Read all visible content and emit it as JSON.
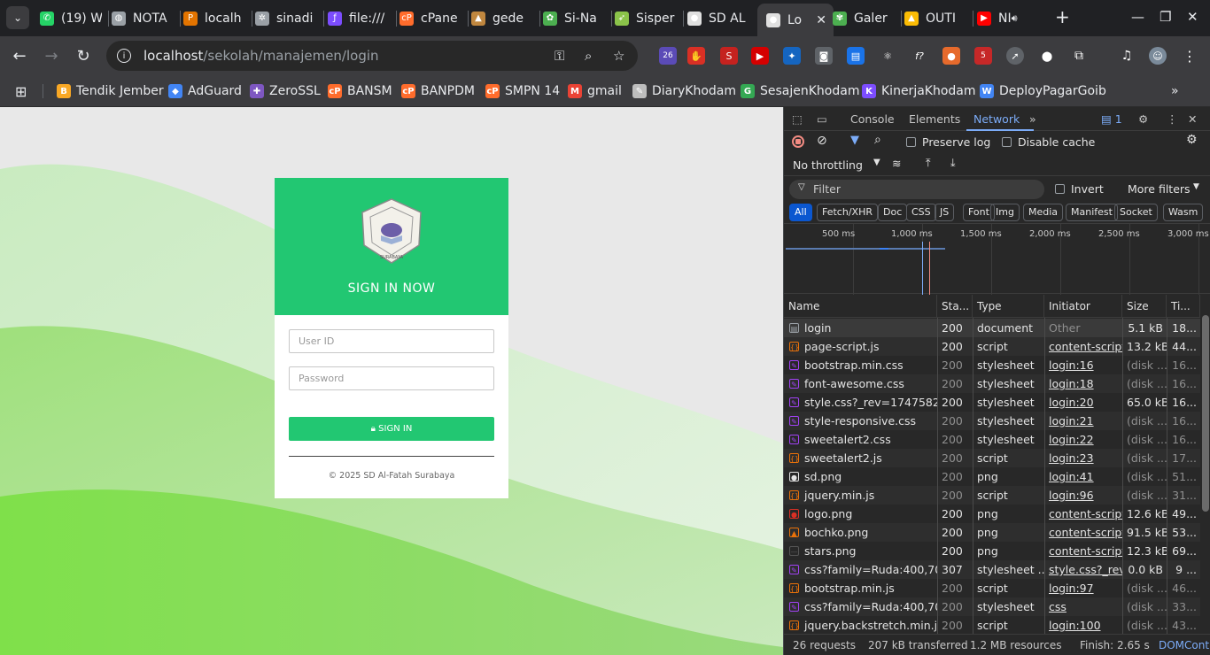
{
  "tabs": [
    {
      "label": "(19) W",
      "color": "#25d366",
      "glyph": "✆"
    },
    {
      "label": "NOTA",
      "color": "#9aa0a6",
      "glyph": "◍"
    },
    {
      "label": "localh",
      "color": "#e37400",
      "glyph": "P"
    },
    {
      "label": "sinadi",
      "color": "#9aa0a6",
      "glyph": "✲"
    },
    {
      "label": "file:///",
      "color": "#7c4dff",
      "glyph": "ƒ"
    },
    {
      "label": "cPane",
      "color": "#ff6c2c",
      "glyph": "cP"
    },
    {
      "label": "gede",
      "color": "#c0873f",
      "glyph": "▲"
    },
    {
      "label": "Si-Na",
      "color": "#4caf50",
      "glyph": "✿"
    },
    {
      "label": "Sisper",
      "color": "#8bc34a",
      "glyph": "➶"
    },
    {
      "label": "SD AL",
      "color": "#e0e0e0",
      "glyph": "●"
    },
    {
      "label": "Lo",
      "color": "#e0e0e0",
      "glyph": "●"
    },
    {
      "label": "Galer",
      "color": "#4caf50",
      "glyph": "✾"
    },
    {
      "label": "OUTI",
      "color": "#fbbc04",
      "glyph": "▲"
    },
    {
      "label": "NI",
      "color": "#ff0000",
      "glyph": "▶"
    }
  ],
  "address": {
    "host": "localhost",
    "path": "/sekolah/manajemen/login"
  },
  "extensions": {
    "badge1": "26",
    "badge2": "5"
  },
  "bookmarks": [
    {
      "label": "Tendik Jember",
      "color": "#f9a825",
      "glyph": "B"
    },
    {
      "label": "AdGuard",
      "color": "#4285f4",
      "glyph": "◆"
    },
    {
      "label": "ZeroSSL",
      "color": "#7e57c2",
      "glyph": "✚"
    },
    {
      "label": "BANSM",
      "color": "#ff6c2c",
      "glyph": "cP"
    },
    {
      "label": "BANPDM",
      "color": "#ff6c2c",
      "glyph": "cP"
    },
    {
      "label": "SMPN 14",
      "color": "#ff6c2c",
      "glyph": "cP"
    },
    {
      "label": "gmail",
      "color": "#ea4335",
      "glyph": "M"
    },
    {
      "label": "DiaryKhodam",
      "color": "#bdbdbd",
      "glyph": "✎"
    },
    {
      "label": "SesajenKhodam",
      "color": "#34a853",
      "glyph": "G"
    },
    {
      "label": "KinerjaKhodam",
      "color": "#7c4dff",
      "glyph": "K"
    },
    {
      "label": "DeployPagarGoib",
      "color": "#4285f4",
      "glyph": "W"
    }
  ],
  "login": {
    "logo_text_top": "SEKOLAH DASAR AL-FATAH",
    "logo_text_bottom": "SURABAYA",
    "title": "SIGN IN NOW",
    "userid_placeholder": "User ID",
    "password_placeholder": "Password",
    "button": "SIGN IN",
    "copyright": "© 2025 SD Al-Fatah Surabaya"
  },
  "devtools": {
    "tabs": [
      "Console",
      "Elements",
      "Network"
    ],
    "issues": "1",
    "preserve_log": "Preserve log",
    "disable_cache": "Disable cache",
    "throttling": "No throttling",
    "filter_placeholder": "Filter",
    "invert": "Invert",
    "more_filters": "More filters",
    "type_filters": [
      "All",
      "Fetch/XHR",
      "Doc",
      "CSS",
      "JS",
      "Font",
      "Img",
      "Media",
      "Manifest",
      "Socket",
      "Wasm"
    ],
    "timeline_labels": [
      "500 ms",
      "1,000 ms",
      "1,500 ms",
      "2,000 ms",
      "2,500 ms",
      "3,000 ms"
    ],
    "columns": [
      "Name",
      "Sta...",
      "Type",
      "Initiator",
      "Size",
      "Ti..."
    ],
    "rows": [
      {
        "name": "login",
        "status": "200",
        "type": "document",
        "initiator": "Other",
        "size": "5.1 kB",
        "time": "18...",
        "icon": "doc"
      },
      {
        "name": "page-script.js",
        "status": "200",
        "type": "script",
        "initiator": "content-script...",
        "size": "13.2 kB",
        "time": "44...",
        "icon": "js"
      },
      {
        "name": "bootstrap.min.css",
        "status": "200",
        "type": "stylesheet",
        "initiator": "login:16",
        "size": "(disk ...",
        "time": "16...",
        "icon": "css"
      },
      {
        "name": "font-awesome.css",
        "status": "200",
        "type": "stylesheet",
        "initiator": "login:18",
        "size": "(disk ...",
        "time": "16...",
        "icon": "css"
      },
      {
        "name": "style.css?_rev=1747582...",
        "status": "200",
        "type": "stylesheet",
        "initiator": "login:20",
        "size": "65.0 kB",
        "time": "16...",
        "icon": "css"
      },
      {
        "name": "style-responsive.css",
        "status": "200",
        "type": "stylesheet",
        "initiator": "login:21",
        "size": "(disk ...",
        "time": "16...",
        "icon": "css"
      },
      {
        "name": "sweetalert2.css",
        "status": "200",
        "type": "stylesheet",
        "initiator": "login:22",
        "size": "(disk ...",
        "time": "16...",
        "icon": "css"
      },
      {
        "name": "sweetalert2.js",
        "status": "200",
        "type": "script",
        "initiator": "login:23",
        "size": "(disk ...",
        "time": "17...",
        "icon": "js"
      },
      {
        "name": "sd.png",
        "status": "200",
        "type": "png",
        "initiator": "login:41",
        "size": "(disk ...",
        "time": "51...",
        "icon": "img"
      },
      {
        "name": "jquery.min.js",
        "status": "200",
        "type": "script",
        "initiator": "login:96",
        "size": "(disk ...",
        "time": "31...",
        "icon": "js"
      },
      {
        "name": "logo.png",
        "status": "200",
        "type": "png",
        "initiator": "content-scripts",
        "size": "12.6 kB",
        "time": "49...",
        "icon": "redimg"
      },
      {
        "name": "bochko.png",
        "status": "200",
        "type": "png",
        "initiator": "content-scripts",
        "size": "91.5 kB",
        "time": "53...",
        "icon": "orgimg"
      },
      {
        "name": "stars.png",
        "status": "200",
        "type": "png",
        "initiator": "content-scripts",
        "size": "12.3 kB",
        "time": "69...",
        "icon": "dash"
      },
      {
        "name": "css?family=Ruda:400,70...",
        "status": "307",
        "type": "stylesheet ...",
        "initiator": "style.css?_rev=",
        "size": "0.0 kB",
        "time": "9 ...",
        "icon": "css"
      },
      {
        "name": "bootstrap.min.js",
        "status": "200",
        "type": "script",
        "initiator": "login:97",
        "size": "(disk ...",
        "time": "46...",
        "icon": "js"
      },
      {
        "name": "css?family=Ruda:400,70...",
        "status": "200",
        "type": "stylesheet",
        "initiator": "css",
        "size": "(disk ...",
        "time": "33...",
        "icon": "css"
      },
      {
        "name": "jquery.backstretch.min.js",
        "status": "200",
        "type": "script",
        "initiator": "login:100",
        "size": "(disk ...",
        "time": "43...",
        "icon": "js"
      }
    ],
    "status": {
      "requests": "26 requests",
      "transferred": "207 kB transferred",
      "resources": "1.2 MB resources",
      "finish": "Finish: 2.65 s",
      "domcontent": "DOMCont"
    }
  }
}
